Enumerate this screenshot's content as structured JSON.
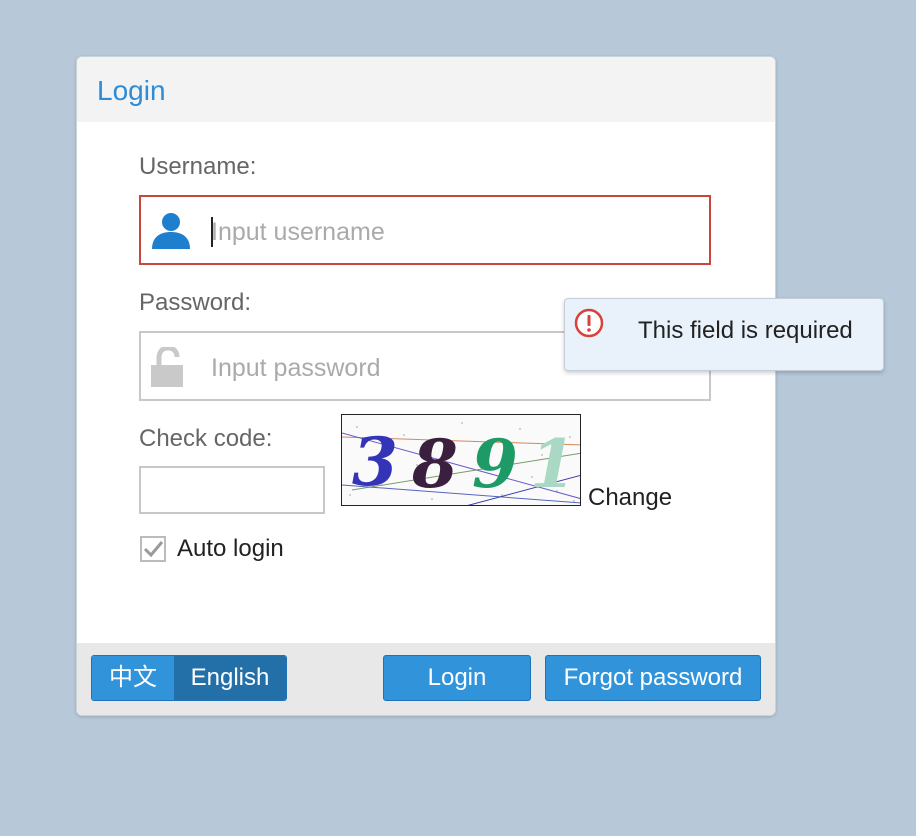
{
  "dialog": {
    "title": "Login"
  },
  "username": {
    "label": "Username:",
    "placeholder": "Input username"
  },
  "password": {
    "label": "Password:",
    "placeholder": "Input password"
  },
  "checkcode": {
    "label": "Check code:",
    "captcha_text": "3891",
    "change_label": "Change"
  },
  "auto_login": {
    "label": "Auto login",
    "checked": true
  },
  "footer": {
    "lang_zh": "中文",
    "lang_en": "English",
    "login_label": "Login",
    "forgot_label": "Forgot password"
  },
  "tooltip": {
    "message": "This field is required"
  },
  "colors": {
    "accent": "#3194db",
    "active_lang": "#236fa8",
    "error": "#c9463d",
    "background": "#b7c9d8"
  },
  "icons": {
    "username": "user-icon",
    "password": "unlock-icon",
    "tooltip": "exclamation-icon",
    "checkbox": "check-icon"
  }
}
